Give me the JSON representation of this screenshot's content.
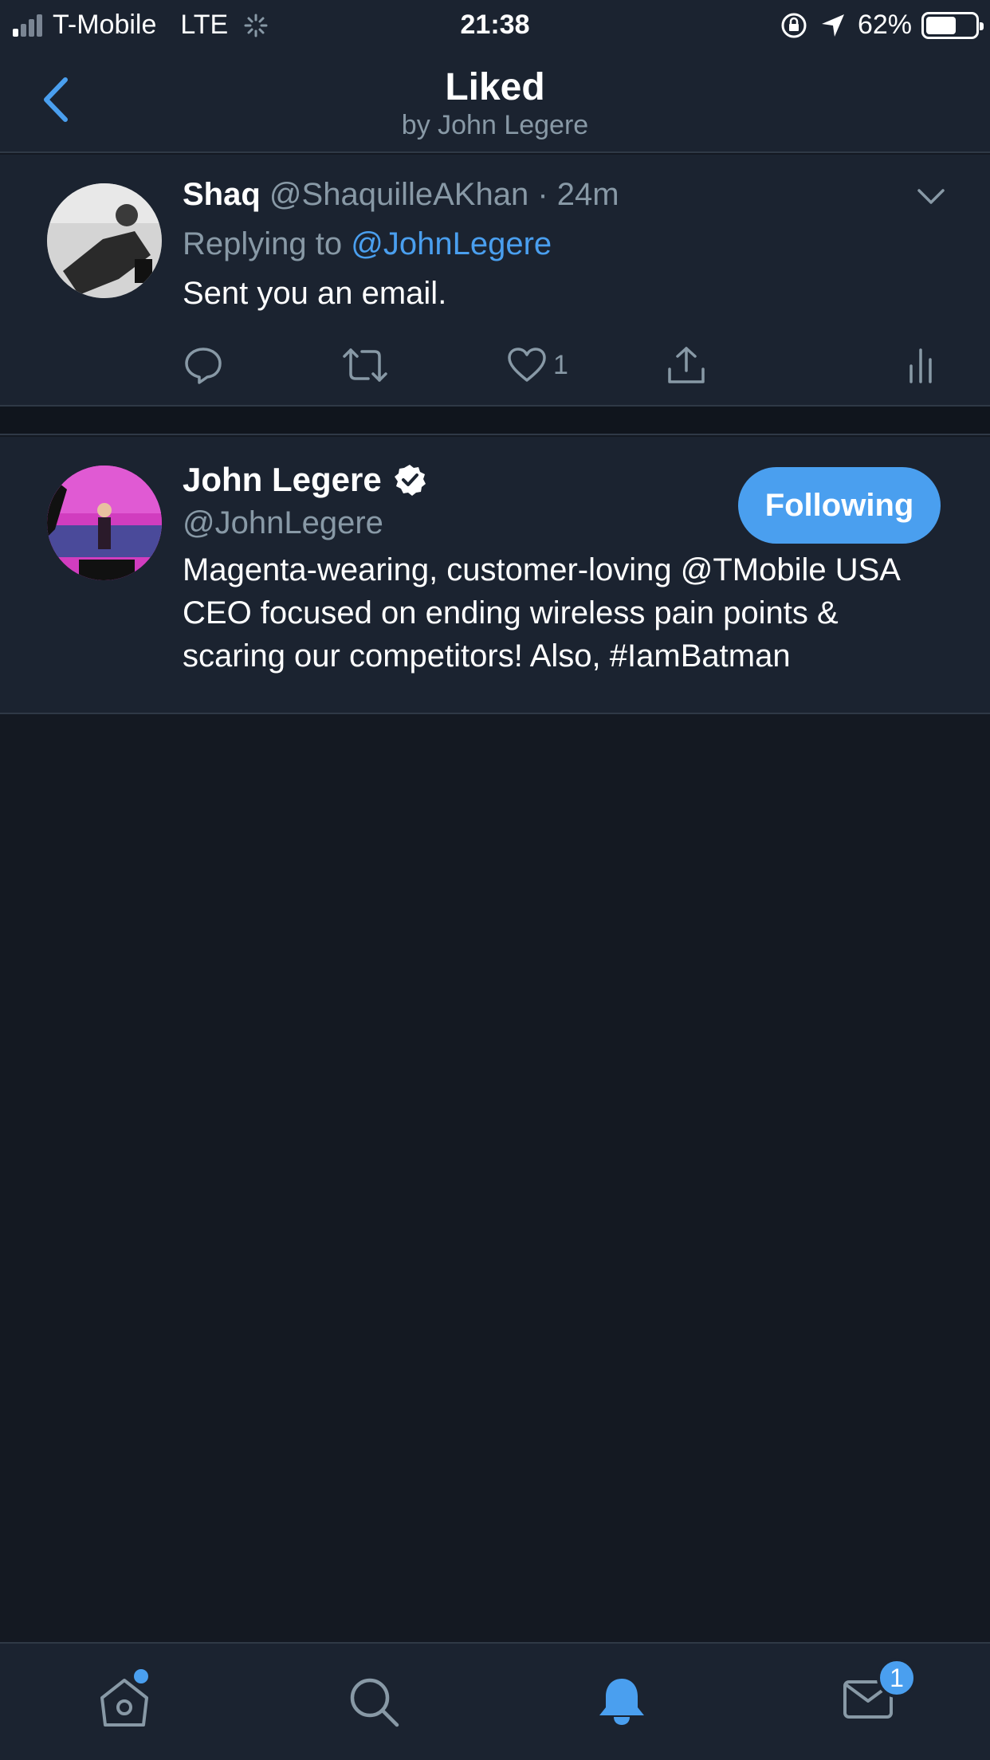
{
  "status_bar": {
    "carrier": "T-Mobile",
    "network": "LTE",
    "time": "21:38",
    "battery": "62%",
    "battery_level": 0.62,
    "signal_bars_filled": 1,
    "signal_bars_total": 4
  },
  "header": {
    "title": "Liked",
    "subtitle": "by John Legere",
    "back_icon": "chevron-left-icon"
  },
  "tweet": {
    "name": "Shaq",
    "handle": "@ShaquilleAKhan",
    "separator": "·",
    "time": "24m",
    "replying_prefix": "Replying to",
    "replying_handle": "@JohnLegere",
    "text": "Sent you an email.",
    "like_count": "1",
    "icons": [
      "reply-icon",
      "retweet-icon",
      "heart-icon",
      "share-icon",
      "analytics-icon",
      "chevron-down-icon"
    ]
  },
  "user_card": {
    "name": "John Legere",
    "handle": "@JohnLegere",
    "bio": "Magenta-wearing, customer-loving @TMobile USA CEO focused on ending wireless pain points & scaring our competitors! Also, #IamBatman",
    "follow_label": "Following",
    "verified_icon": "verified-badge-icon"
  },
  "tab_bar": {
    "tabs": [
      "home-icon",
      "search-icon",
      "notifications-icon",
      "messages-icon"
    ],
    "active": "notifications-icon",
    "messages_badge": "1"
  },
  "colors": {
    "background": "#141922",
    "surface": "#1b2330",
    "accent": "#4a9fef",
    "muted_text": "#8899a6",
    "divider": "#2f3946"
  }
}
